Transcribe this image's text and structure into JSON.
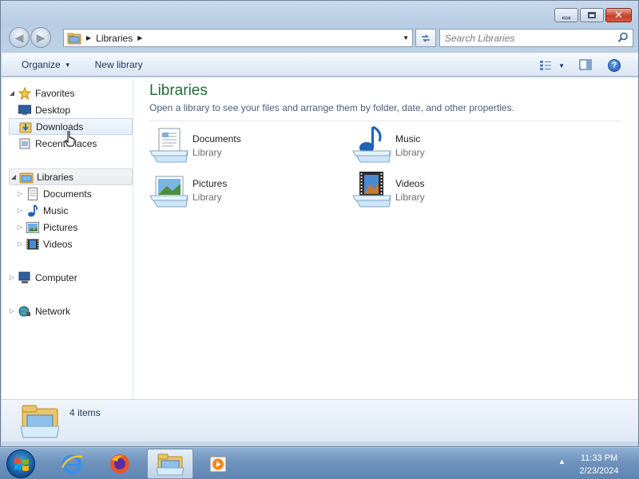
{
  "window": {
    "minimize_label": "Minimize",
    "maximize_label": "Maximize",
    "close_label": "Close"
  },
  "address": {
    "crumbs": [
      "Libraries"
    ]
  },
  "search": {
    "placeholder": "Search Libraries"
  },
  "toolbar": {
    "organize_label": "Organize",
    "new_library_label": "New library"
  },
  "nav_pane": {
    "favorites": {
      "label": "Favorites",
      "items": [
        {
          "label": "Desktop"
        },
        {
          "label": "Downloads"
        },
        {
          "label": "Recent Places"
        }
      ]
    },
    "libraries": {
      "label": "Libraries",
      "items": [
        {
          "label": "Documents"
        },
        {
          "label": "Music"
        },
        {
          "label": "Pictures"
        },
        {
          "label": "Videos"
        }
      ]
    },
    "computer": {
      "label": "Computer"
    },
    "network": {
      "label": "Network"
    }
  },
  "main": {
    "title": "Libraries",
    "subtitle": "Open a library to see your files and arrange them by folder, date, and other properties.",
    "items": [
      {
        "name": "Documents",
        "type": "Library",
        "icon": "documents-library-icon"
      },
      {
        "name": "Music",
        "type": "Library",
        "icon": "music-library-icon"
      },
      {
        "name": "Pictures",
        "type": "Library",
        "icon": "pictures-library-icon"
      },
      {
        "name": "Videos",
        "type": "Library",
        "icon": "videos-library-icon"
      }
    ]
  },
  "details": {
    "count": "4 items"
  },
  "taskbar": {
    "apps": [
      "internet-explorer-icon",
      "firefox-icon",
      "windows-explorer-icon",
      "media-player-icon"
    ],
    "time": "11:33 PM",
    "date": "2/23/2024"
  },
  "colors": {
    "title_green": "#226b35",
    "toolbar_text": "#1e395b",
    "taskbar": "#6f93bd"
  }
}
